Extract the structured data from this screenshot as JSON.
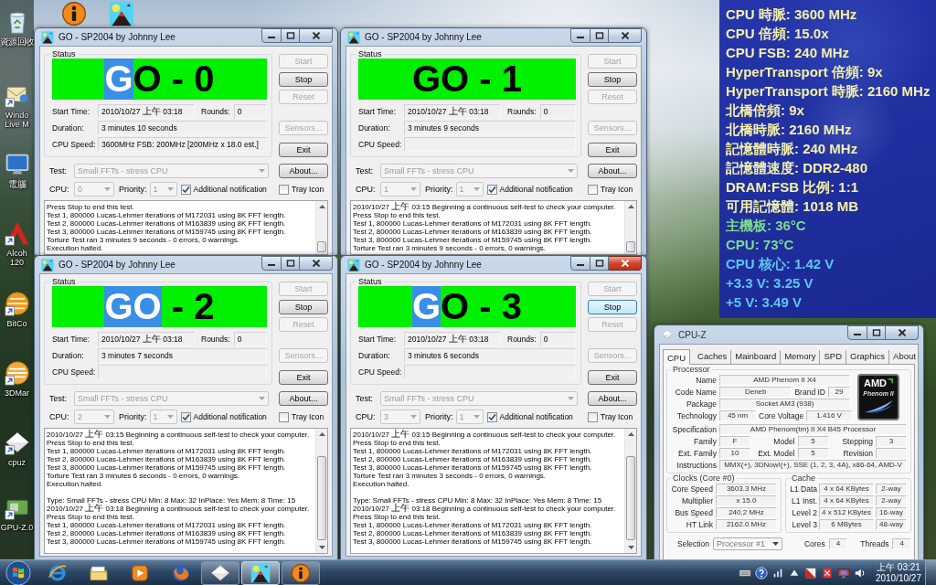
{
  "desktop": {
    "icons": [
      {
        "kind": "recycle-bin",
        "label": [
          "資源回收"
        ]
      },
      {
        "kind": "info"
      },
      {
        "kind": "go-app"
      },
      {
        "kind": "messenger",
        "label": [
          "Windo",
          "Live M"
        ]
      },
      {
        "kind": "computer",
        "label": [
          "電腦"
        ]
      },
      {
        "kind": "alcohol",
        "label": [
          "Alcoh",
          "120"
        ]
      },
      {
        "kind": "bitcomet",
        "label": [
          "BitCo"
        ]
      },
      {
        "kind": "benchmark",
        "label": [
          "3DMar"
        ]
      },
      {
        "kind": "cpuz",
        "label": [
          "cpuz"
        ]
      },
      {
        "kind": "gpuz",
        "label": [
          "GPU-Z.0"
        ]
      }
    ]
  },
  "go_windows": [
    {
      "title": "GO - SP2004 by Johnny Lee",
      "active": false,
      "status_label": "Status",
      "banner": [
        {
          "text": "G",
          "highlighted": true
        },
        {
          "text": "O - 0",
          "highlighted": false
        }
      ],
      "start_time": {
        "label": "Start Time:",
        "value": "2010/10/27 上午 03:18"
      },
      "rounds": {
        "label": "Rounds:",
        "value": "0"
      },
      "duration": {
        "label": "Duration:",
        "value": "3 minutes 10 seconds"
      },
      "cpu_speed": {
        "label": "CPU Speed:",
        "value": "3600MHz FSB: 200MHz [200MHz x 18.0 est.]"
      },
      "buttons": [
        {
          "label": "Start",
          "disabled": true,
          "focused": false
        },
        {
          "label": "Stop",
          "disabled": false,
          "focused": false
        },
        {
          "label": "Reset",
          "disabled": true,
          "focused": false
        },
        {
          "label": "Sensors...",
          "disabled": true,
          "focused": false
        },
        {
          "label": "Exit",
          "disabled": false,
          "focused": false
        },
        {
          "label": "About...",
          "disabled": false,
          "focused": false
        }
      ],
      "test": {
        "label": "Test:",
        "value": "Small FFTs - stress CPU",
        "disabled": true
      },
      "cpu": {
        "label": "CPU:",
        "value": "0",
        "disabled": true
      },
      "priority": {
        "label": "Priority:",
        "value": "1",
        "disabled": true
      },
      "checkboxes": [
        {
          "label": "Additional notification",
          "checked": true
        },
        {
          "label": "Tray Icon",
          "checked": false
        }
      ],
      "log": [
        {
          "lines": [
            "Press Stop to end this test.",
            "Test 1, 800000 Lucas-Lehmer iterations of M172031 using 8K FFT length.",
            "Test 2, 800000 Lucas-Lehmer iterations of M163839 using 8K FFT length.",
            "Test 3, 800000 Lucas-Lehmer iterations of M159745 using 8K FFT length.",
            "Torture Test ran 3 minutes 9 seconds - 0 errors, 0 warnings.",
            "Execution halted."
          ]
        }
      ]
    },
    {
      "title": "GO - SP2004 by Johnny Lee",
      "active": false,
      "status_label": "Status",
      "banner": [
        {
          "text": "GO - 1",
          "highlighted": false
        }
      ],
      "start_time": {
        "label": "Start Time:",
        "value": "2010/10/27 上午 03:18"
      },
      "rounds": {
        "label": "Rounds:",
        "value": "0"
      },
      "duration": {
        "label": "Duration:",
        "value": "3 minutes 9 seconds"
      },
      "cpu_speed": {
        "label": "CPU Speed:"
      },
      "buttons": [
        {
          "label": "Start",
          "disabled": true,
          "focused": false
        },
        {
          "label": "Stop",
          "disabled": false,
          "focused": false
        },
        {
          "label": "Reset",
          "disabled": true,
          "focused": false
        },
        {
          "label": "Sensors...",
          "disabled": true,
          "focused": false
        },
        {
          "label": "Exit",
          "disabled": false,
          "focused": false
        },
        {
          "label": "About...",
          "disabled": false,
          "focused": false
        }
      ],
      "test": {
        "label": "Test:",
        "value": "Small FFTs - stress CPU",
        "disabled": true
      },
      "cpu": {
        "label": "CPU:",
        "value": "1",
        "disabled": true
      },
      "priority": {
        "label": "Priority:",
        "value": "1",
        "disabled": true
      },
      "checkboxes": [
        {
          "label": "Additional notification",
          "checked": true
        },
        {
          "label": "Tray Icon",
          "checked": false
        }
      ],
      "log": [
        {
          "lines": [
            "2010/10/27 上午 03:15 Beginning a continuous self-test to check your computer.",
            "Press Stop to end this test.",
            "Test 1, 800000 Lucas-Lehmer iterations of M172031 using 8K FFT length.",
            "Test 2, 800000 Lucas-Lehmer iterations of M163839 using 8K FFT length.",
            "Test 3, 800000 Lucas-Lehmer iterations of M159745 using 8K FFT length.",
            "Torture Test ran 3 minutes 9 seconds - 0 errors, 0 warnings."
          ]
        }
      ]
    },
    {
      "title": "GO - SP2004 by Johnny Lee",
      "active": false,
      "status_label": "Status",
      "banner": [
        {
          "text": "GO",
          "highlighted": true
        },
        {
          "text": " - 2",
          "highlighted": false
        }
      ],
      "start_time": {
        "label": "Start Time:",
        "value": "2010/10/27 上午 03:18"
      },
      "rounds": {
        "label": "Rounds:",
        "value": "0"
      },
      "duration": {
        "label": "Duration:",
        "value": "3 minutes 7 seconds"
      },
      "cpu_speed": {
        "label": "CPU Speed:"
      },
      "buttons": [
        {
          "label": "Start",
          "disabled": true,
          "focused": false
        },
        {
          "label": "Stop",
          "disabled": false,
          "focused": false
        },
        {
          "label": "Reset",
          "disabled": true,
          "focused": false
        },
        {
          "label": "Sensors...",
          "disabled": true,
          "focused": false
        },
        {
          "label": "Exit",
          "disabled": false,
          "focused": false
        },
        {
          "label": "About...",
          "disabled": false,
          "focused": false
        }
      ],
      "test": {
        "label": "Test:",
        "value": "Small FFTs - stress CPU",
        "disabled": true
      },
      "cpu": {
        "label": "CPU:",
        "value": "2",
        "disabled": true
      },
      "priority": {
        "label": "Priority:",
        "value": "1",
        "disabled": true
      },
      "checkboxes": [
        {
          "label": "Additional notification",
          "checked": true
        },
        {
          "label": "Tray Icon",
          "checked": false
        }
      ],
      "log": [
        {
          "lines": [
            "2010/10/27 上午 03:15 Beginning a continuous self-test to check your computer.",
            "Press Stop to end this test.",
            "Test 1, 800000 Lucas-Lehmer iterations of M172031 using 8K FFT length.",
            "Test 2, 800000 Lucas-Lehmer iterations of M163839 using 8K FFT length.",
            "Test 3, 800000 Lucas-Lehmer iterations of M159745 using 8K FFT length.",
            "Torture Test ran 3 minutes 6 seconds - 0 errors, 0 warnings.",
            "Execution halted."
          ]
        },
        {
          "lines": [
            "Type: Small FFTs - stress CPU Min: 8 Max: 32 InPlace: Yes Mem: 8 Time: 15",
            "2010/10/27 上午 03:18 Beginning a continuous self-test to check your computer.",
            "Press Stop to end this test.",
            "Test 1, 800000 Lucas-Lehmer iterations of M172031 using 8K FFT length.",
            "Test 2, 800000 Lucas-Lehmer iterations of M163839 using 8K FFT length.",
            "Test 3, 800000 Lucas-Lehmer iterations of M159745 using 8K FFT length."
          ]
        }
      ]
    },
    {
      "title": "GO - SP2004 by Johnny Lee",
      "active": true,
      "status_label": "Status",
      "banner": [
        {
          "text": "G",
          "highlighted": true
        },
        {
          "text": "O - 3",
          "highlighted": false
        }
      ],
      "start_time": {
        "label": "Start Time:",
        "value": "2010/10/27 上午 03:18"
      },
      "rounds": {
        "label": "Rounds:",
        "value": "0"
      },
      "duration": {
        "label": "Duration:",
        "value": "3 minutes 6 seconds"
      },
      "cpu_speed": {
        "label": "CPU Speed:"
      },
      "buttons": [
        {
          "label": "Start",
          "disabled": true,
          "focused": false
        },
        {
          "label": "Stop",
          "disabled": false,
          "focused": true
        },
        {
          "label": "Reset",
          "disabled": true,
          "focused": false
        },
        {
          "label": "Sensors...",
          "disabled": true,
          "focused": false
        },
        {
          "label": "Exit",
          "disabled": false,
          "focused": false
        },
        {
          "label": "About...",
          "disabled": false,
          "focused": false
        }
      ],
      "test": {
        "label": "Test:",
        "value": "Small FFTs - stress CPU",
        "disabled": true
      },
      "cpu": {
        "label": "CPU:",
        "value": "3",
        "disabled": true
      },
      "priority": {
        "label": "Priority:",
        "value": "1",
        "disabled": true
      },
      "checkboxes": [
        {
          "label": "Additional notification",
          "checked": true
        },
        {
          "label": "Tray Icon",
          "checked": false
        }
      ],
      "log": [
        {
          "lines": [
            "2010/10/27 上午 03:15 Beginning a continuous self-test to check your computer.",
            "Press Stop to end this test.",
            "Test 1, 800000 Lucas-Lehmer iterations of M172031 using 8K FFT length.",
            "Test 2, 800000 Lucas-Lehmer iterations of M163839 using 8K FFT length.",
            "Test 3, 800000 Lucas-Lehmer iterations of M159745 using 8K FFT length.",
            "Torture Test ran 3 minutes 3 seconds - 0 errors, 0 warnings.",
            "Execution halted."
          ]
        },
        {
          "lines": [
            "Type: Small FFTs - stress CPU Min: 8 Max: 32 InPlace: Yes Mem: 8 Time: 15",
            "2010/10/27 上午 03:18 Beginning a continuous self-test to check your computer.",
            "Press Stop to end this test.",
            "Test 1, 800000 Lucas-Lehmer iterations of M172031 using 8K FFT length.",
            "Test 2, 800000 Lucas-Lehmer iterations of M163839 using 8K FFT length.",
            "Test 3, 800000 Lucas-Lehmer iterations of M159745 using 8K FFT length."
          ]
        }
      ]
    }
  ],
  "sensor_gadget": {
    "lines": [
      {
        "text": "CPU 時脈: 3600 MHz",
        "color": "#f3f0a8"
      },
      {
        "text": "CPU 倍頻: 15.0x",
        "color": "#f3f0a8"
      },
      {
        "text": "CPU FSB: 240 MHz",
        "color": "#f3f0a8"
      },
      {
        "text": "HyperTransport 倍頻: 9x",
        "color": "#f3f0a8"
      },
      {
        "text": "HyperTransport 時脈: 2160 MHz",
        "color": "#f3f0a8"
      },
      {
        "text": "北橋倍頻: 9x",
        "color": "#f3f0a8"
      },
      {
        "text": "北橋時脈: 2160 MHz",
        "color": "#f3f0a8"
      },
      {
        "text": "記憶體時脈: 240 MHz",
        "color": "#f3f0a8"
      },
      {
        "text": "記憶體速度: DDR2-480",
        "color": "#f3f0a8"
      },
      {
        "text": "DRAM:FSB 比例: 1:1",
        "color": "#f3f0a8"
      },
      {
        "text": "可用記憶體: 1018 MB",
        "color": "#f3f0a8"
      },
      {
        "text": "主機板: 36°C",
        "color": "#7fdc8c"
      },
      {
        "text": "CPU: 73°C",
        "color": "#7fdc8c"
      },
      {
        "text": "CPU 核心: 1.42 V",
        "color": "#5cc6f2"
      },
      {
        "text": "+3.3 V: 3.25 V",
        "color": "#5cc6f2"
      },
      {
        "text": "+5 V: 3.49 V",
        "color": "#5cc6f2"
      }
    ]
  },
  "cpuz": {
    "title": "CPU-Z",
    "tabs": [
      {
        "label": "CPU",
        "selected": true
      },
      {
        "label": "Caches",
        "selected": false
      },
      {
        "label": "Mainboard",
        "selected": false
      },
      {
        "label": "Memory",
        "selected": false
      },
      {
        "label": "SPD",
        "selected": false
      },
      {
        "label": "Graphics",
        "selected": false
      },
      {
        "label": "About",
        "selected": false
      }
    ],
    "processor": {
      "label": "Processor",
      "upper_rows": [
        [
          {
            "label": "Name",
            "value": "AMD Phenom II X4"
          }
        ],
        [
          {
            "label": "Code Name",
            "value": "Deneb"
          },
          {
            "label": "Brand ID",
            "value": "29"
          }
        ],
        [
          {
            "label": "Package",
            "value": "Socket AM3 (938)"
          }
        ],
        [
          {
            "label": "Technology",
            "value": "45 nm"
          },
          {
            "label": "Core Voltage",
            "value": "1.416 V"
          }
        ]
      ],
      "logo": {
        "brand": "AMD",
        "product": "Phenom II"
      },
      "lower_rows": [
        [
          {
            "label": "Specification",
            "value": "AMD Phenom(tm) II X4 B45 Processor"
          }
        ],
        [
          {
            "label": "Family",
            "value": "F"
          },
          {
            "label": "Model",
            "value": "5"
          },
          {
            "label": "Stepping",
            "value": "3"
          }
        ],
        [
          {
            "label": "Ext. Family",
            "value": "10"
          },
          {
            "label": "Ext. Model",
            "value": "5"
          },
          {
            "label": "Revision"
          }
        ],
        [
          {
            "label": "Instructions",
            "value": "MMX(+), 3DNow!(+), SSE (1, 2, 3, 4A), x86-64, AMD-V"
          }
        ]
      ]
    },
    "clocks": {
      "label": "Clocks (Core #0)",
      "rows": [
        {
          "label": "Core Speed",
          "value": "3603.3 MHz"
        },
        {
          "label": "Multiplier",
          "value": "x 15.0"
        },
        {
          "label": "Bus Speed",
          "value": "240.2 MHz"
        },
        {
          "label": "HT Link",
          "value": "2162.0 MHz"
        }
      ]
    },
    "cache": {
      "label": "Cache",
      "rows": [
        {
          "label": "L1 Data",
          "value": "4 x 64 KBytes",
          "ways": "2-way"
        },
        {
          "label": "L1 Inst.",
          "value": "4 x 64 KBytes",
          "ways": "2-way"
        },
        {
          "label": "Level 2",
          "value": "4 x 512 KBytes",
          "ways": "16-way"
        },
        {
          "label": "Level 3",
          "value": "6 MBytes",
          "ways": "48-way"
        }
      ]
    },
    "selection": {
      "label": "Selection",
      "value": "Processor #1"
    },
    "cores": {
      "label": "Cores",
      "value": "4"
    },
    "threads": {
      "label": "Threads",
      "value": "4"
    }
  },
  "taskbar": {
    "programs": [
      {
        "kind": "ie",
        "running": false,
        "selected": false
      },
      {
        "kind": "explorer",
        "running": false,
        "selected": false
      },
      {
        "kind": "media-player",
        "running": false,
        "selected": false
      },
      {
        "kind": "firefox",
        "running": false,
        "selected": false
      },
      {
        "kind": "cpuz",
        "running": true,
        "selected": false
      },
      {
        "kind": "go-app",
        "running": true,
        "selected": true
      },
      {
        "kind": "info",
        "running": true,
        "selected": false
      }
    ],
    "tray": [
      {
        "kind": "keyboard"
      },
      {
        "kind": "help"
      },
      {
        "kind": "network"
      },
      {
        "kind": "expand"
      },
      {
        "kind": "alert-flag"
      },
      {
        "kind": "alert-cross"
      },
      {
        "kind": "alert-monitor"
      },
      {
        "kind": "speaker"
      }
    ],
    "clock": {
      "time": "上午 03:21",
      "date": "2010/10/27"
    }
  }
}
